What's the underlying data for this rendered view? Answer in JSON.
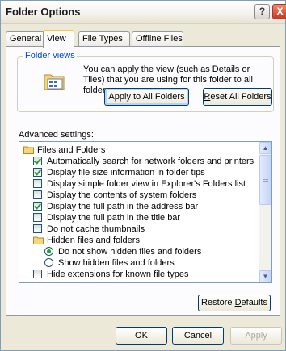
{
  "window": {
    "title": "Folder Options",
    "help_label": "?",
    "close_label": "X"
  },
  "tabs": [
    {
      "label": "General",
      "active": false
    },
    {
      "label": "View",
      "active": true
    },
    {
      "label": "File Types",
      "active": false
    },
    {
      "label": "Offline Files",
      "active": false
    }
  ],
  "folder_views": {
    "label": "Folder views",
    "description": "You can apply the view (such as Details or Tiles) that you are using for this folder to all folders.",
    "apply_label": "Apply to All Folders",
    "reset_prefix": "",
    "reset_mnemonic": "R",
    "reset_rest": "eset All Folders"
  },
  "advanced": {
    "label": "Advanced settings:",
    "items": [
      {
        "type": "folder",
        "label": "Files and Folders"
      },
      {
        "type": "checkbox",
        "checked": true,
        "label": "Automatically search for network folders and printers"
      },
      {
        "type": "checkbox",
        "checked": true,
        "label": "Display file size information in folder tips"
      },
      {
        "type": "checkbox",
        "checked": false,
        "label": "Display simple folder view in Explorer's Folders list"
      },
      {
        "type": "checkbox",
        "checked": false,
        "label": "Display the contents of system folders"
      },
      {
        "type": "checkbox",
        "checked": true,
        "label": "Display the full path in the address bar"
      },
      {
        "type": "checkbox",
        "checked": false,
        "label": "Display the full path in the title bar"
      },
      {
        "type": "checkbox",
        "checked": false,
        "label": "Do not cache thumbnails"
      },
      {
        "type": "subfolder",
        "label": "Hidden files and folders"
      },
      {
        "type": "radio",
        "checked": true,
        "label": "Do not show hidden files and folders"
      },
      {
        "type": "radio",
        "checked": false,
        "label": "Show hidden files and folders"
      },
      {
        "type": "checkbox",
        "checked": false,
        "label": "Hide extensions for known file types"
      }
    ]
  },
  "restore": {
    "prefix": "Restore ",
    "mnemonic": "D",
    "rest": "efaults"
  },
  "dialog": {
    "ok_label": "OK",
    "cancel_label": "Cancel",
    "apply_label": "Apply"
  },
  "colors": {
    "accent_tab": "#ffc73c",
    "check_green": "#21a121",
    "group_label": "#0046d5"
  }
}
